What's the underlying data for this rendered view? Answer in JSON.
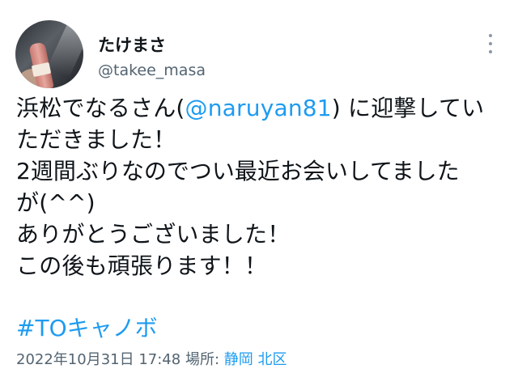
{
  "user": {
    "display_name": "たけまさ",
    "handle": "@takee_masa"
  },
  "more_icon": "more-dots-vertical-icon",
  "tweet": {
    "line1_before": "浜松でなるさん(",
    "line1_mention": "@naruyan81",
    "line1_after": ") に迎撃してい",
    "line2": "ただきました！",
    "line3": "2週間ぶりなのでつい最近お会いしてましたが",
    "line4": "が(^^)",
    "line5": "ありがとうございました！",
    "line6": "この後も頑張ります！！",
    "hashtag": "#TOキャノボ"
  },
  "meta": {
    "timestamp": "2022年10月31日 17:48",
    "location_label": "場所:",
    "location": "静岡 北区"
  },
  "colors": {
    "link": "#1d9bf0",
    "text": "#0f1419",
    "secondary": "#536471"
  }
}
